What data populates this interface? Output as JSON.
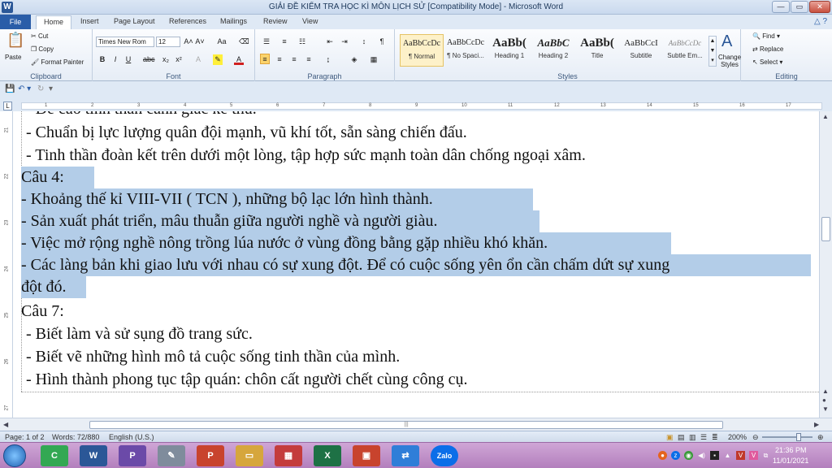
{
  "window": {
    "title": "GIẢI ĐỀ KIỂM TRA HỌC KÌ MÔN LỊCH SỬ [Compatibility Mode] - Microsoft Word"
  },
  "tabs": [
    "File",
    "Home",
    "Insert",
    "Page Layout",
    "References",
    "Mailings",
    "Review",
    "View"
  ],
  "ribbon": {
    "clipboard": {
      "paste": "Paste",
      "cut": "Cut",
      "copy": "Copy",
      "format_painter": "Format Painter",
      "label": "Clipboard"
    },
    "font": {
      "name": "Times New Rom",
      "size": "12",
      "label": "Font"
    },
    "paragraph": {
      "label": "Paragraph"
    },
    "styles": {
      "items": [
        {
          "sample": "AaBbCcDc",
          "name": "¶ Normal"
        },
        {
          "sample": "AaBbCcDc",
          "name": "¶ No Spaci..."
        },
        {
          "sample": "AaBb(",
          "name": "Heading 1"
        },
        {
          "sample": "AaBbC",
          "name": "Heading 2"
        },
        {
          "sample": "AaBb(",
          "name": "Title"
        },
        {
          "sample": "AaBbCcI",
          "name": "Subtitle"
        },
        {
          "sample": "AaBbCcDc",
          "name": "Subtle Em..."
        }
      ],
      "change_styles": "Change Styles",
      "label": "Styles"
    },
    "editing": {
      "find": "Find",
      "replace": "Replace",
      "select": "Select",
      "label": "Editing"
    }
  },
  "ruler": {
    "h_numbers": [
      "1",
      "2",
      "3",
      "4",
      "5",
      "6",
      "7",
      "8",
      "9",
      "10",
      "11",
      "12",
      "13",
      "14",
      "15",
      "16",
      "17"
    ],
    "v_numbers": [
      "21",
      "22",
      "23",
      "24",
      "25",
      "26",
      "27"
    ]
  },
  "document": {
    "partial_top": "- Đề cao tinh thần cảnh giác kẻ thù.",
    "lines": [
      {
        "text": "- Chuẩn bị lực lượng quân đội mạnh, vũ khí tốt, sẵn sàng chiến đấu.",
        "selected": false
      },
      {
        "text": "- Tinh thần đoàn kết trên dưới một lòng, tập hợp sức mạnh toàn dân chống ngoại xâm.",
        "selected": false
      },
      {
        "text": "Câu 4:",
        "selected": true
      },
      {
        "text": "- Khoảng thế kỉ VIII-VII ( TCN ), những bộ lạc lớn hình thành.",
        "selected": true
      },
      {
        "text": "- Sản xuất phát triển, mâu thuẫn giữa người nghề và người giàu.",
        "selected": true
      },
      {
        "text": "- Việc mở rộng nghề nông trồng lúa nước ở vùng đồng bằng gặp nhiều khó khăn.",
        "selected": true
      },
      {
        "text": "- Các làng bản khi giao lưu với nhau có sự xung đột. Để có cuộc sống yên ổn cần chấm dứt sự xung",
        "selected": true
      },
      {
        "text": "đột đó.",
        "selected": true
      },
      {
        "text": "Câu 7:",
        "selected": false
      },
      {
        "text": "- Biết làm và sử sụng đồ trang sức.",
        "selected": false
      },
      {
        "text": "- Biết vẽ những hình mô tả cuộc sống tinh thần của mình.",
        "selected": false
      },
      {
        "text": "- Hình thành phong tục tập quán: chôn cất người chết cùng công cụ.",
        "selected": false
      }
    ]
  },
  "statusbar": {
    "page": "Page: 1 of 2",
    "words": "Words: 72/880",
    "language": "English (U.S.)",
    "zoom": "200%",
    "zoom_fraction": 0.72
  },
  "taskbar": {
    "apps": [
      {
        "label": "C",
        "color": "#33a853"
      },
      {
        "label": "W",
        "color": "#2b5797"
      },
      {
        "label": "P",
        "color": "#6b4aa8"
      },
      {
        "label": "✎",
        "color": "#7f8c9c"
      },
      {
        "label": "P",
        "color": "#c8432d"
      },
      {
        "label": "▭",
        "color": "#d6a63c"
      },
      {
        "label": "▦",
        "color": "#c43c3c"
      },
      {
        "label": "X",
        "color": "#1e7145"
      },
      {
        "label": "▣",
        "color": "#c8432d"
      },
      {
        "label": "⇄",
        "color": "#2f7ed8"
      },
      {
        "label": "Zalo",
        "color": "#0b6ee8"
      }
    ],
    "time": "21:36 PM",
    "date": "11/01/2021"
  }
}
